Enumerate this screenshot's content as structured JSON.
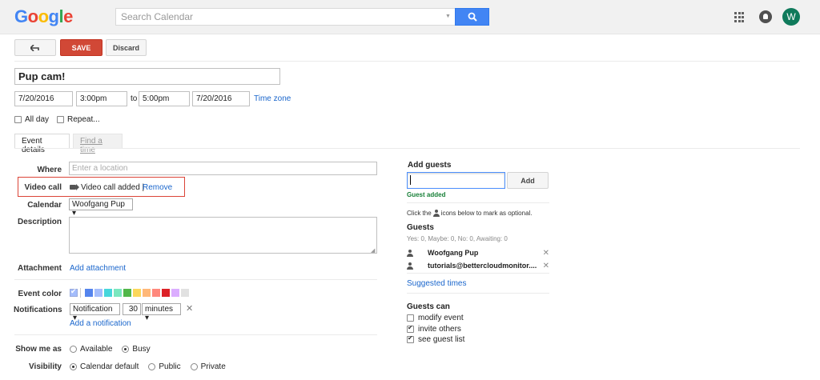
{
  "header": {
    "logo_letters": [
      {
        "ch": "G",
        "color": "#4285f4"
      },
      {
        "ch": "o",
        "color": "#ea4335"
      },
      {
        "ch": "o",
        "color": "#fbbc05"
      },
      {
        "ch": "g",
        "color": "#4285f4"
      },
      {
        "ch": "l",
        "color": "#34a853"
      },
      {
        "ch": "e",
        "color": "#ea4335"
      }
    ],
    "search_placeholder": "Search Calendar",
    "avatar_letter": "W"
  },
  "toolbar": {
    "back_label": "⬿",
    "save_label": "SAVE",
    "discard_label": "Discard"
  },
  "event": {
    "title": "Pup cam!",
    "start_date": "7/20/2016",
    "start_time": "3:00pm",
    "to_label": "to",
    "end_time": "5:00pm",
    "end_date": "7/20/2016",
    "timezone_label": "Time zone",
    "allday_label": "All day",
    "repeat_label": "Repeat..."
  },
  "tabs": {
    "event_details": "Event details",
    "find_time": "Find a time"
  },
  "form": {
    "where_label": "Where",
    "where_placeholder": "Enter a location",
    "video_label": "Video call",
    "video_status": "Video call added |",
    "video_remove": "Remove",
    "calendar_label": "Calendar",
    "calendar_value": "Woofgang Pup ▾",
    "description_label": "Description",
    "attachment_label": "Attachment",
    "attachment_link": "Add attachment",
    "event_color_label": "Event color",
    "colors": [
      "#a4bdfc",
      "#5484ed",
      "#a4bdfc",
      "#46d6db",
      "#7ae7bf",
      "#51b749",
      "#fbd75b",
      "#ffb878",
      "#ff887c",
      "#dc2127",
      "#dbadff",
      "#e1e1e1"
    ],
    "notifications_label": "Notifications",
    "notification_type": "Notification ▾",
    "notification_num": "30",
    "notification_unit": "minutes ▾",
    "notification_remove": "✕",
    "add_notification": "Add a notification",
    "showme_label": "Show me as",
    "showme_options": [
      "Available",
      "Busy"
    ],
    "visibility_label": "Visibility",
    "visibility_options": [
      "Calendar default",
      "Public",
      "Private"
    ]
  },
  "guests": {
    "heading": "Add guests",
    "add_button": "Add",
    "added_status": "Guest added",
    "optional_note_pre": "Click the",
    "optional_note_post": "icons below to mark as optional.",
    "list_title": "Guests",
    "stats": "Yes: 0, Maybe: 0, No: 0, Awaiting: 0",
    "list": [
      "Woofgang Pup",
      "tutorials@bettercloudmonitor...."
    ],
    "remove_glyph": "✕",
    "suggested_times": "Suggested times",
    "can_heading": "Guests can",
    "permissions": [
      "modify event",
      "invite others",
      "see guest list"
    ]
  }
}
